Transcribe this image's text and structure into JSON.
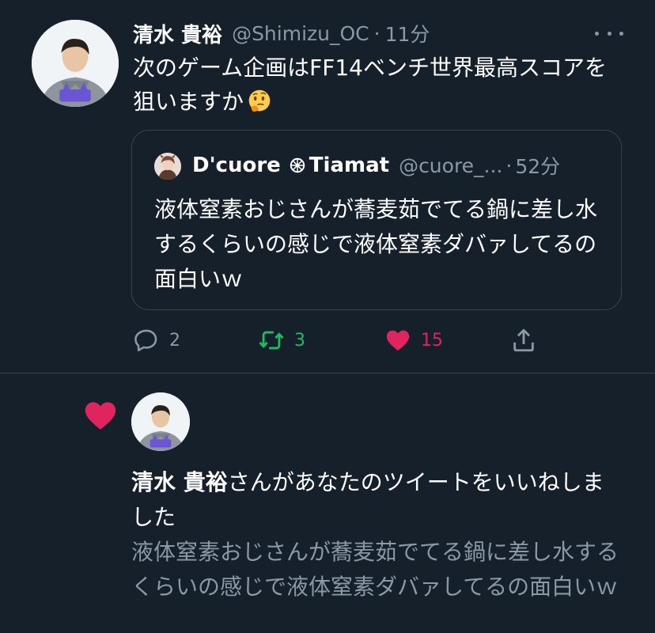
{
  "tweet": {
    "author_name": "清水 貴裕",
    "handle": "@Shimizu_OC",
    "separator": "·",
    "time": "11分",
    "text": "次のゲーム企画はFF14ベンチ世界最高スコアを狙いますか",
    "emoji": "thinking-face-emoji"
  },
  "quote": {
    "author_name": "D'cuore",
    "author_name_suffix": "Tiamat",
    "handle": "@cuore_...",
    "separator": "·",
    "time": "52分",
    "text": "液体窒素おじさんが蕎麦茹でてる鍋に差し水するくらいの感じで液体窒素ダバァしてるの面白いｗ"
  },
  "actions": {
    "reply_count": "2",
    "retweet_count": "3",
    "like_count": "15"
  },
  "colors": {
    "background": "#15202b",
    "secondary_text": "#8b98a5",
    "retweet_green": "#17bf63",
    "like_pink": "#e0245e",
    "border": "#38444d"
  },
  "notification": {
    "liker_name": "清水 貴裕",
    "message": "さんがあなたのツイートをいいねしました",
    "liked_tweet_text": "液体窒素おじさんが蕎麦茹でてる鍋に差し水するくらいの感じで液体窒素ダバァしてるの面白いｗ"
  }
}
